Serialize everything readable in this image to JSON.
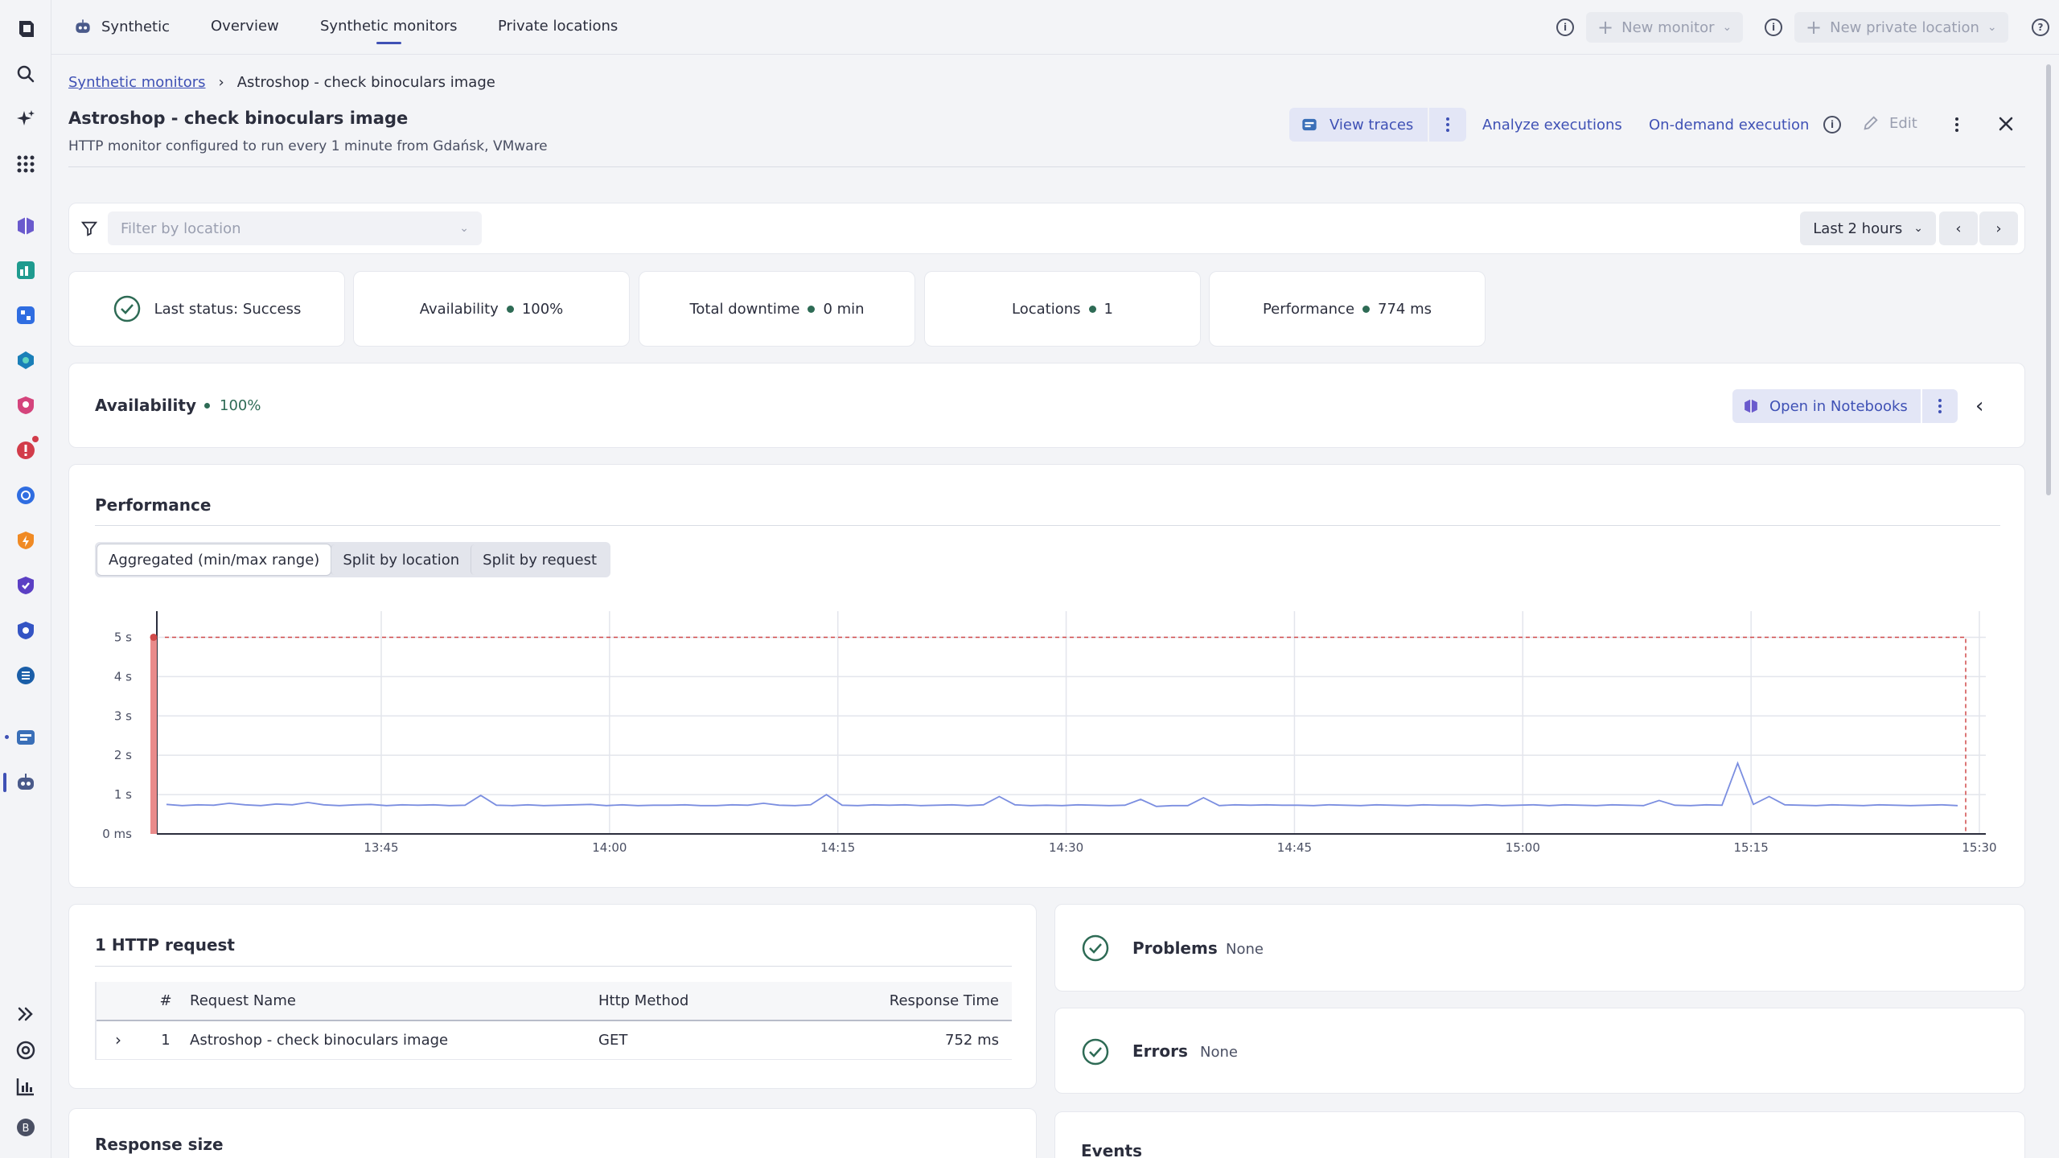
{
  "topbar": {
    "app_name": "Synthetic",
    "tabs": [
      "Overview",
      "Synthetic monitors",
      "Private locations"
    ],
    "active_tab": "Synthetic monitors",
    "new_monitor_label": "New monitor",
    "new_private_location_label": "New private location"
  },
  "breadcrumb": {
    "parent": "Synthetic monitors",
    "current": "Astroshop - check binoculars image"
  },
  "header": {
    "title": "Astroshop - check binoculars image",
    "subtitle": "HTTP monitor configured to run every 1 minute from Gdańsk, VMware",
    "view_traces_label": "View traces",
    "analyze_executions_label": "Analyze executions",
    "on_demand_label": "On-demand execution",
    "edit_label": "Edit"
  },
  "filter": {
    "location_placeholder": "Filter by location",
    "timeframe": "Last 2 hours"
  },
  "kpis": {
    "last_status": "Last status: Success",
    "availability_label": "Availability",
    "availability_value": "100%",
    "downtime_label": "Total downtime",
    "downtime_value": "0 min",
    "locations_label": "Locations",
    "locations_value": "1",
    "performance_label": "Performance",
    "performance_value": "774 ms"
  },
  "availability_card": {
    "title": "Availability",
    "value": "100%",
    "open_notebooks_label": "Open in Notebooks"
  },
  "performance_card": {
    "title": "Performance",
    "tabs": [
      "Aggregated (min/max range)",
      "Split by location",
      "Split by request"
    ],
    "active_tab": "Aggregated (min/max range)"
  },
  "chart_data": {
    "type": "line",
    "y_ticks": [
      "0 ms",
      "1 s",
      "2 s",
      "3 s",
      "4 s",
      "5 s"
    ],
    "y_tick_values": [
      0,
      1,
      2,
      3,
      4,
      5
    ],
    "x_ticks": [
      "13:45",
      "14:00",
      "14:15",
      "14:30",
      "14:45",
      "15:00",
      "15:15",
      "15:30"
    ],
    "ylim": [
      0,
      5.5
    ],
    "threshold_seconds": 5,
    "series": [
      {
        "values": [
          0.75,
          0.72,
          0.74,
          0.73,
          0.78,
          0.74,
          0.72,
          0.76,
          0.74,
          0.8,
          0.74,
          0.72,
          0.74,
          0.75,
          0.72,
          0.74,
          0.73,
          0.74,
          0.72,
          0.73,
          0.98,
          0.73,
          0.72,
          0.74,
          0.72,
          0.73,
          0.74,
          0.75,
          0.72,
          0.74,
          0.72,
          0.73,
          0.73,
          0.74,
          0.72,
          0.72,
          0.74,
          0.73,
          0.78,
          0.73,
          0.72,
          0.74,
          1.0,
          0.73,
          0.72,
          0.74,
          0.73,
          0.74,
          0.72,
          0.73,
          0.74,
          0.72,
          0.74,
          0.95,
          0.74,
          0.72,
          0.73,
          0.72,
          0.74,
          0.73,
          0.72,
          0.73,
          0.88,
          0.7,
          0.72,
          0.72,
          0.92,
          0.72,
          0.74,
          0.73,
          0.74,
          0.73,
          0.73,
          0.72,
          0.74,
          0.73,
          0.72,
          0.74,
          0.73,
          0.72,
          0.74,
          0.73,
          0.73,
          0.72,
          0.74,
          0.72,
          0.73,
          0.74,
          0.72,
          0.74,
          0.73,
          0.72,
          0.74,
          0.73,
          0.72,
          0.85,
          0.73,
          0.72,
          0.74,
          0.73,
          1.8,
          0.75,
          0.95,
          0.74,
          0.73,
          0.72,
          0.74,
          0.73,
          0.72,
          0.74,
          0.73,
          0.72,
          0.73,
          0.74,
          0.72
        ]
      }
    ]
  },
  "http_requests": {
    "title": "1 HTTP request",
    "columns": [
      "#",
      "Request Name",
      "Http Method",
      "Response Time"
    ],
    "rows": [
      {
        "num": "1",
        "name": "Astroshop - check binoculars image",
        "method": "GET",
        "time": "752 ms"
      }
    ]
  },
  "problems": {
    "title": "Problems",
    "value": "None"
  },
  "errors": {
    "title": "Errors",
    "value": "None"
  },
  "response_size": {
    "title": "Response size"
  },
  "events": {
    "title": "Events"
  },
  "colors": {
    "accent": "#3f51b5",
    "success": "#2e6b55",
    "line": "#7b8ee0",
    "threshold": "#d04a4a"
  }
}
